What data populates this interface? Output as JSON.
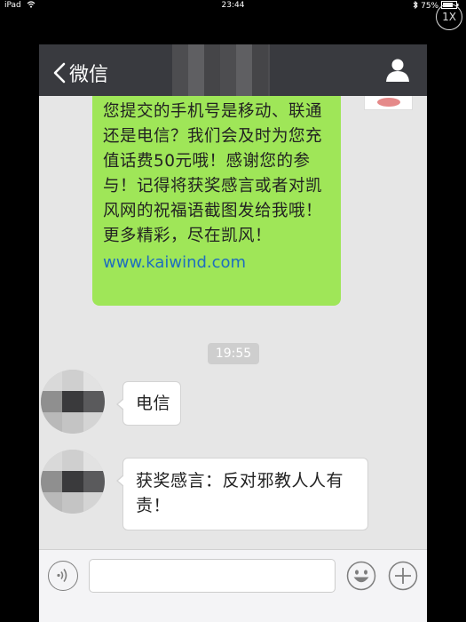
{
  "status_bar": {
    "device": "iPad",
    "time": "23:44",
    "battery": "75%"
  },
  "zoom_button": {
    "label": "1X"
  },
  "navbar": {
    "back_label": "微信"
  },
  "messages": {
    "green_text": "您提交的手机号是移动、联通还是电信？我们会及时为您充值话费50元哦！感谢您的参与！记得将获奖感言或者对凯风网的祝福语截图发给我哦！更多精彩，尽在凯风！",
    "green_link": "www.kaiwind.com",
    "timestamp": "19:55",
    "reply1": "电信",
    "reply2": "获奖感言：反对邪教人人有责！"
  },
  "icons": [
    "wifi-icon",
    "bluetooth-icon",
    "battery-icon",
    "back-chevron-icon",
    "user-icon",
    "voice-icon",
    "emoji-icon",
    "plus-icon"
  ],
  "colors": {
    "navbar": "#393a3f",
    "green_bubble": "#9fe658",
    "link": "#1e6dbf",
    "chat_bg": "#e6e6e6"
  }
}
